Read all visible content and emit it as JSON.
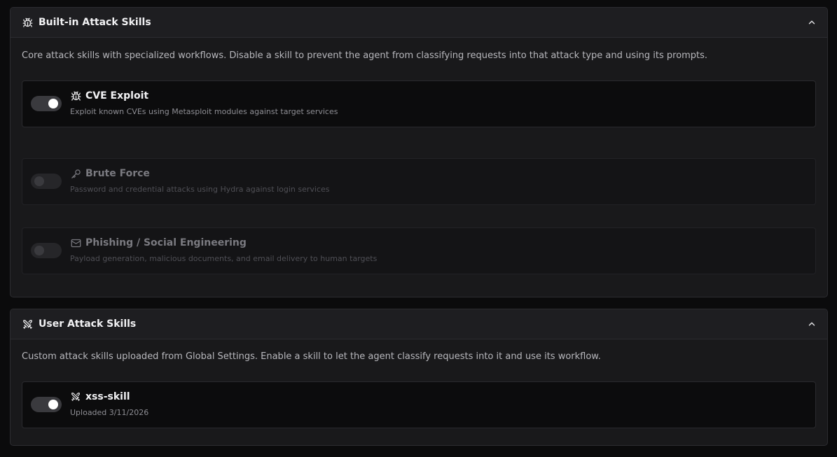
{
  "builtin": {
    "title": "Built-in Attack Skills",
    "icon": "bug-icon",
    "description": "Core attack skills with specialized workflows. Disable a skill to prevent the agent from classifying requests into that attack type and using its prompts.",
    "collapse_icon": "chevron-up-icon",
    "skills": [
      {
        "name": "CVE Exploit",
        "icon": "bug-icon",
        "description": "Exploit known CVEs using Metasploit modules against target services",
        "enabled": true
      },
      {
        "name": "Brute Force",
        "icon": "key-icon",
        "description": "Password and credential attacks using Hydra against login services",
        "enabled": false
      },
      {
        "name": "Phishing / Social Engineering",
        "icon": "mail-icon",
        "description": "Payload generation, malicious documents, and email delivery to human targets",
        "enabled": false
      }
    ]
  },
  "user": {
    "title": "User Attack Skills",
    "icon": "crossed-swords-icon",
    "description": "Custom attack skills uploaded from Global Settings. Enable a skill to let the agent classify requests into it and use its workflow.",
    "collapse_icon": "chevron-up-icon",
    "skills": [
      {
        "name": "xss-skill",
        "icon": "crossed-swords-icon",
        "description": "Uploaded 3/11/2026",
        "enabled": true
      }
    ]
  }
}
